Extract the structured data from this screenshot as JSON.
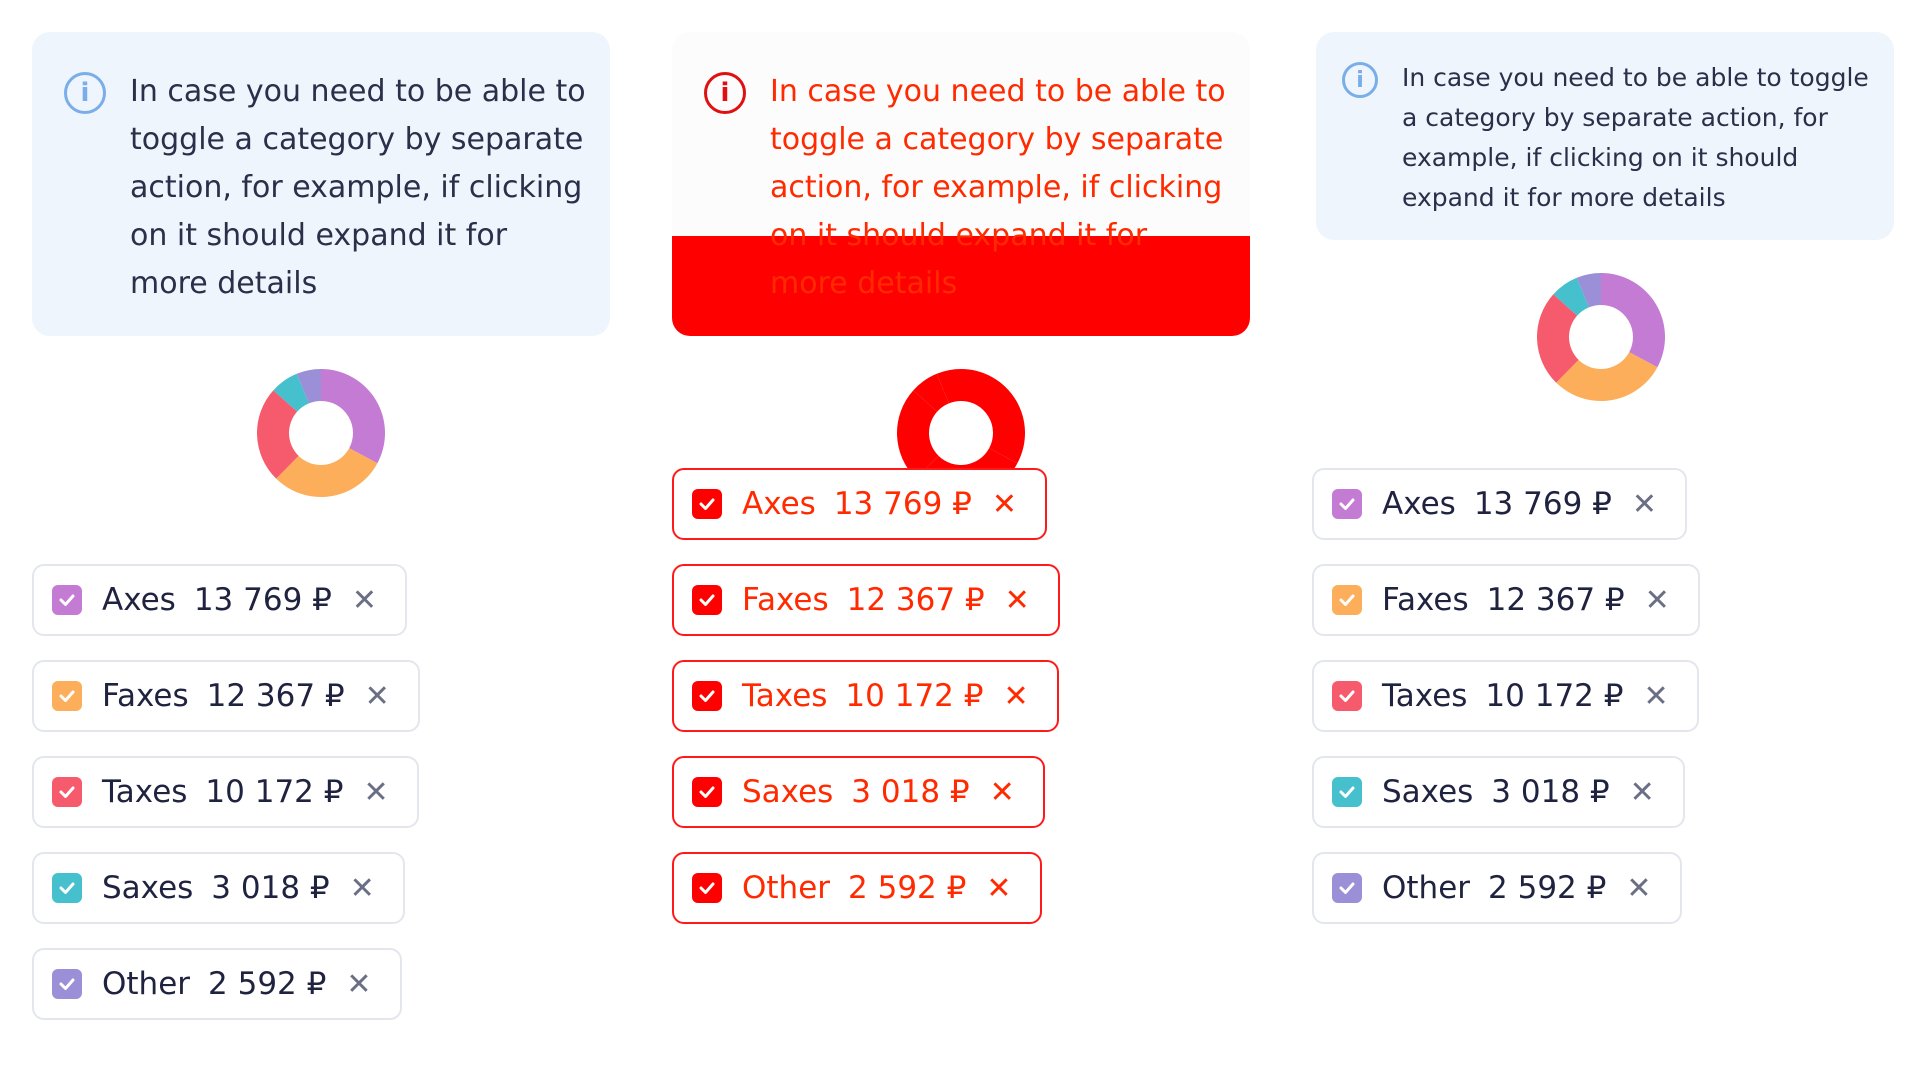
{
  "notice": {
    "text": "In case you need to be able to toggle a category by separate action, for example, if clicking on it should expand it for more details",
    "icon": "info-icon"
  },
  "colors": {
    "highlight": "#ff0000",
    "notice_bg": "#eff5fc",
    "info_icon": "#7aaee8"
  },
  "panels": [
    {
      "categories": [
        {
          "label": "Axes",
          "value": "13 769 ₽",
          "checked": true,
          "color": "#c37bd4"
        },
        {
          "label": "Faxes",
          "value": "12 367 ₽",
          "checked": true,
          "color": "#fcae5b"
        },
        {
          "label": "Taxes",
          "value": "10 172 ₽",
          "checked": true,
          "color": "#f65a6d"
        },
        {
          "label": "Saxes",
          "value": "3 018 ₽",
          "checked": true,
          "color": "#46c0cc"
        },
        {
          "label": "Other",
          "value": "2 592 ₽",
          "checked": true,
          "color": "#9b8fd8"
        }
      ]
    },
    {
      "categories": [
        {
          "label": "Axes",
          "value": "13 769 ₽",
          "checked": true,
          "color": "#ff0000"
        },
        {
          "label": "Faxes",
          "value": "12 367 ₽",
          "checked": true,
          "color": "#ff0000"
        },
        {
          "label": "Taxes",
          "value": "10 172 ₽",
          "checked": true,
          "color": "#ff0000"
        },
        {
          "label": "Saxes",
          "value": "3 018 ₽",
          "checked": true,
          "color": "#ff0000"
        },
        {
          "label": "Other",
          "value": "2 592 ₽",
          "checked": true,
          "color": "#ff0000"
        }
      ]
    },
    {
      "categories": [
        {
          "label": "Axes",
          "value": "13 769 ₽",
          "checked": true,
          "color": "#c37bd4"
        },
        {
          "label": "Faxes",
          "value": "12 367 ₽",
          "checked": true,
          "color": "#fcae5b"
        },
        {
          "label": "Taxes",
          "value": "10 172 ₽",
          "checked": true,
          "color": "#f65a6d"
        },
        {
          "label": "Saxes",
          "value": "3 018 ₽",
          "checked": true,
          "color": "#46c0cc"
        },
        {
          "label": "Other",
          "value": "2 592 ₽",
          "checked": true,
          "color": "#9b8fd8"
        }
      ]
    }
  ],
  "chart_data": [
    {
      "type": "pie",
      "categories": [
        "Axes",
        "Faxes",
        "Taxes",
        "Saxes",
        "Other"
      ],
      "values": [
        13769,
        12367,
        10172,
        3018,
        2592
      ],
      "colors": [
        "#c37bd4",
        "#fcae5b",
        "#f65a6d",
        "#46c0cc",
        "#9b8fd8"
      ]
    },
    {
      "type": "pie",
      "categories": [
        "Axes",
        "Faxes",
        "Taxes",
        "Saxes",
        "Other"
      ],
      "values": [
        13769,
        12367,
        10172,
        3018,
        2592
      ],
      "colors": [
        "#ff0000",
        "#ff0000",
        "#ff0000",
        "#ff0000",
        "#ff0000"
      ]
    },
    {
      "type": "pie",
      "categories": [
        "Axes",
        "Faxes",
        "Taxes",
        "Saxes",
        "Other"
      ],
      "values": [
        13769,
        12367,
        10172,
        3018,
        2592
      ],
      "colors": [
        "#c37bd4",
        "#fcae5b",
        "#f65a6d",
        "#46c0cc",
        "#9b8fd8"
      ]
    }
  ]
}
